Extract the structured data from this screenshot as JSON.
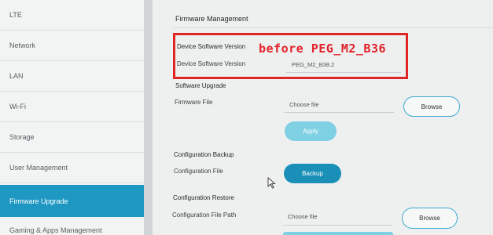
{
  "sidebar": {
    "items": [
      {
        "label": "LTE",
        "active": false
      },
      {
        "label": "Network",
        "active": false
      },
      {
        "label": "LAN",
        "active": false
      },
      {
        "label": "Wi-Fi",
        "active": false
      },
      {
        "label": "Storage",
        "active": false
      },
      {
        "label": "User Management",
        "active": false
      },
      {
        "label": "Firmware Upgrade",
        "active": true
      },
      {
        "label": "Gaming & Apps Management",
        "active": false
      }
    ]
  },
  "page": {
    "title": "Firmware Management"
  },
  "device_version": {
    "section_title": "Device Software Version",
    "label": "Device Software Version",
    "value": "PEG_M2_B38.2"
  },
  "software_upgrade": {
    "section_title": "Software Upgrade",
    "label": "Firmware File",
    "file_value": "Choose file",
    "browse_label": "Browse",
    "apply_label": "Apply"
  },
  "config_backup": {
    "section_title": "Configuration Backup",
    "label": "Configuration File",
    "backup_label": "Backup"
  },
  "config_restore": {
    "section_title": "Configuration Restore",
    "label": "Configuration File Path",
    "file_value": "Choose file",
    "browse_label": "Browse"
  },
  "annotation": {
    "text": "before PEG_M2_B36"
  },
  "colors": {
    "accent": "#1e98c2",
    "apply_disabled": "#7fd0e2",
    "backup": "#1a90b8",
    "annotation_red": "#e02527"
  }
}
